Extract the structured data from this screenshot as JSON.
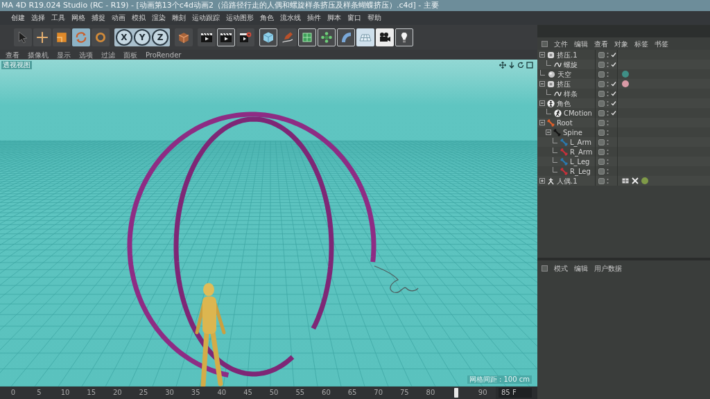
{
  "window": {
    "title": "MA 4D R19.024 Studio (RC - R19) - [动画第13个c4d动画2（沿路径行走的人偶和螺旋样条挤压及样条蝴蝶挤压）.c4d] - 主要"
  },
  "menu_bar": [
    "创建",
    "选择",
    "工具",
    "网格",
    "捕捉",
    "动画",
    "模拟",
    "渲染",
    "雕刻",
    "运动跟踪",
    "运动图形",
    "角色",
    "流水线",
    "插件",
    "脚本",
    "窗口",
    "帮助"
  ],
  "toolbar": {
    "tools": [
      {
        "selected": false
      },
      {
        "selected": false
      },
      {
        "selected": false
      },
      {
        "selected": true
      },
      {
        "selected": false
      }
    ],
    "axes": [
      {
        "label": "X",
        "on": true
      },
      {
        "label": "Y",
        "on": true
      },
      {
        "label": "Z",
        "on": true
      }
    ],
    "render_buttons": [
      {
        "selected": false
      },
      {
        "selected": true
      },
      {
        "selected": false
      }
    ]
  },
  "viewport": {
    "menus": [
      "查看",
      "摄像机",
      "显示",
      "选项",
      "过滤",
      "面板",
      "ProRender"
    ],
    "label": "透视视图",
    "grid_info": "网格间距 : 100 cm"
  },
  "timeline": {
    "ticks": [
      "0",
      "5",
      "10",
      "15",
      "20",
      "25",
      "30",
      "35",
      "40",
      "45",
      "50",
      "55",
      "60",
      "65",
      "70",
      "75",
      "80",
      "90"
    ],
    "level": 0.944,
    "frame": "85 F"
  },
  "object_manager": {
    "tabs": [
      "文件",
      "编辑",
      "查看",
      "对象",
      "标签",
      "书签"
    ],
    "objects": [
      {
        "name": "挤压.1",
        "kind": "extrude",
        "enabled": true,
        "expanded": true,
        "children": [
          {
            "name": "螺旋",
            "kind": "spline",
            "enabled": true
          }
        ]
      },
      {
        "name": "天空",
        "kind": "sky",
        "enabled": false,
        "tags": [
          {
            "kind": "material",
            "color": "#3f8f86"
          }
        ]
      },
      {
        "name": "挤压",
        "kind": "extrude",
        "enabled": true,
        "expanded": true,
        "tags": [
          {
            "kind": "material",
            "color": "#d99aa6"
          }
        ],
        "children": [
          {
            "name": "样条",
            "kind": "spline",
            "enabled": true
          }
        ]
      },
      {
        "name": "角色",
        "kind": "character",
        "enabled": true,
        "expanded": true,
        "children": [
          {
            "name": "CMotion",
            "kind": "cmotion",
            "enabled": true
          }
        ]
      },
      {
        "name": "Root",
        "kind": "joint",
        "color": "#e0602a",
        "enabled": false,
        "expanded": true,
        "children": [
          {
            "name": "Spine",
            "kind": "joint",
            "color": "#151515",
            "enabled": false,
            "expanded": true,
            "children": [
              {
                "name": "L_Arm",
                "kind": "joint",
                "color": "#2a7ab0",
                "enabled": false
              },
              {
                "name": "R_Arm",
                "kind": "joint",
                "color": "#c8303a",
                "enabled": false
              },
              {
                "name": "L_Leg",
                "kind": "joint",
                "color": "#2a7ab0",
                "enabled": false
              },
              {
                "name": "R_Leg",
                "kind": "joint",
                "color": "#c8303a",
                "enabled": false
              }
            ]
          }
        ]
      },
      {
        "name": "人偶.1",
        "kind": "figure",
        "enabled": false,
        "expanded": false,
        "tags": [
          {
            "kind": "texture"
          },
          {
            "kind": "ik"
          },
          {
            "kind": "material",
            "color": "#7f9a48"
          }
        ]
      }
    ]
  },
  "attributes": {
    "tabs": [
      "模式",
      "编辑",
      "用户数据"
    ]
  }
}
